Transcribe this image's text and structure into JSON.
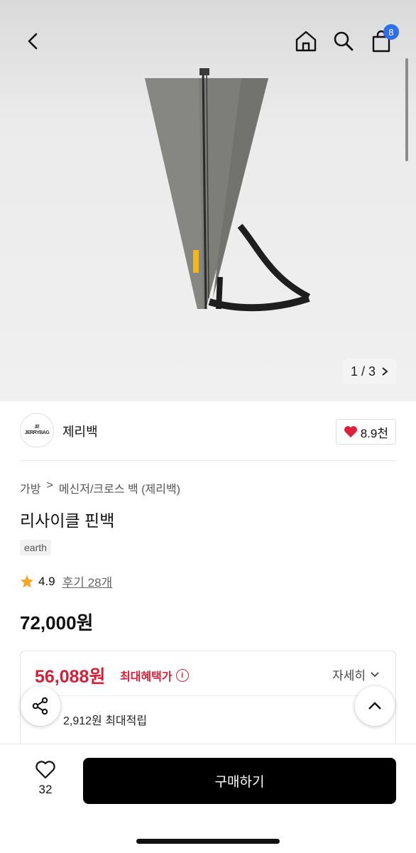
{
  "topbar": {
    "icons": [
      "back-icon",
      "home-icon",
      "search-icon",
      "bag-icon"
    ],
    "cart_count": "8"
  },
  "gallery": {
    "pager": "1 / 3"
  },
  "brand": {
    "name": "제리백",
    "logo_text": "JERRYBAG",
    "likes": "8.9천"
  },
  "breadcrumb": {
    "category": "가방",
    "subcategory": "메신저/크로스 백 (제리백)"
  },
  "product": {
    "title": "리사이클 핀백",
    "tag": "earth",
    "rating": "4.9",
    "reviews": "후기 28개",
    "price": "72,000원"
  },
  "benefit": {
    "price": "56,088원",
    "label": "최대혜택가",
    "detail": "자세히",
    "points": "2,912원 최대적립"
  },
  "bottom": {
    "wish_count": "32",
    "buy_label": "구매하기"
  },
  "colors": {
    "accent_red": "#d4213a",
    "badge_blue": "#2f6fe4",
    "star": "#f5a623"
  }
}
